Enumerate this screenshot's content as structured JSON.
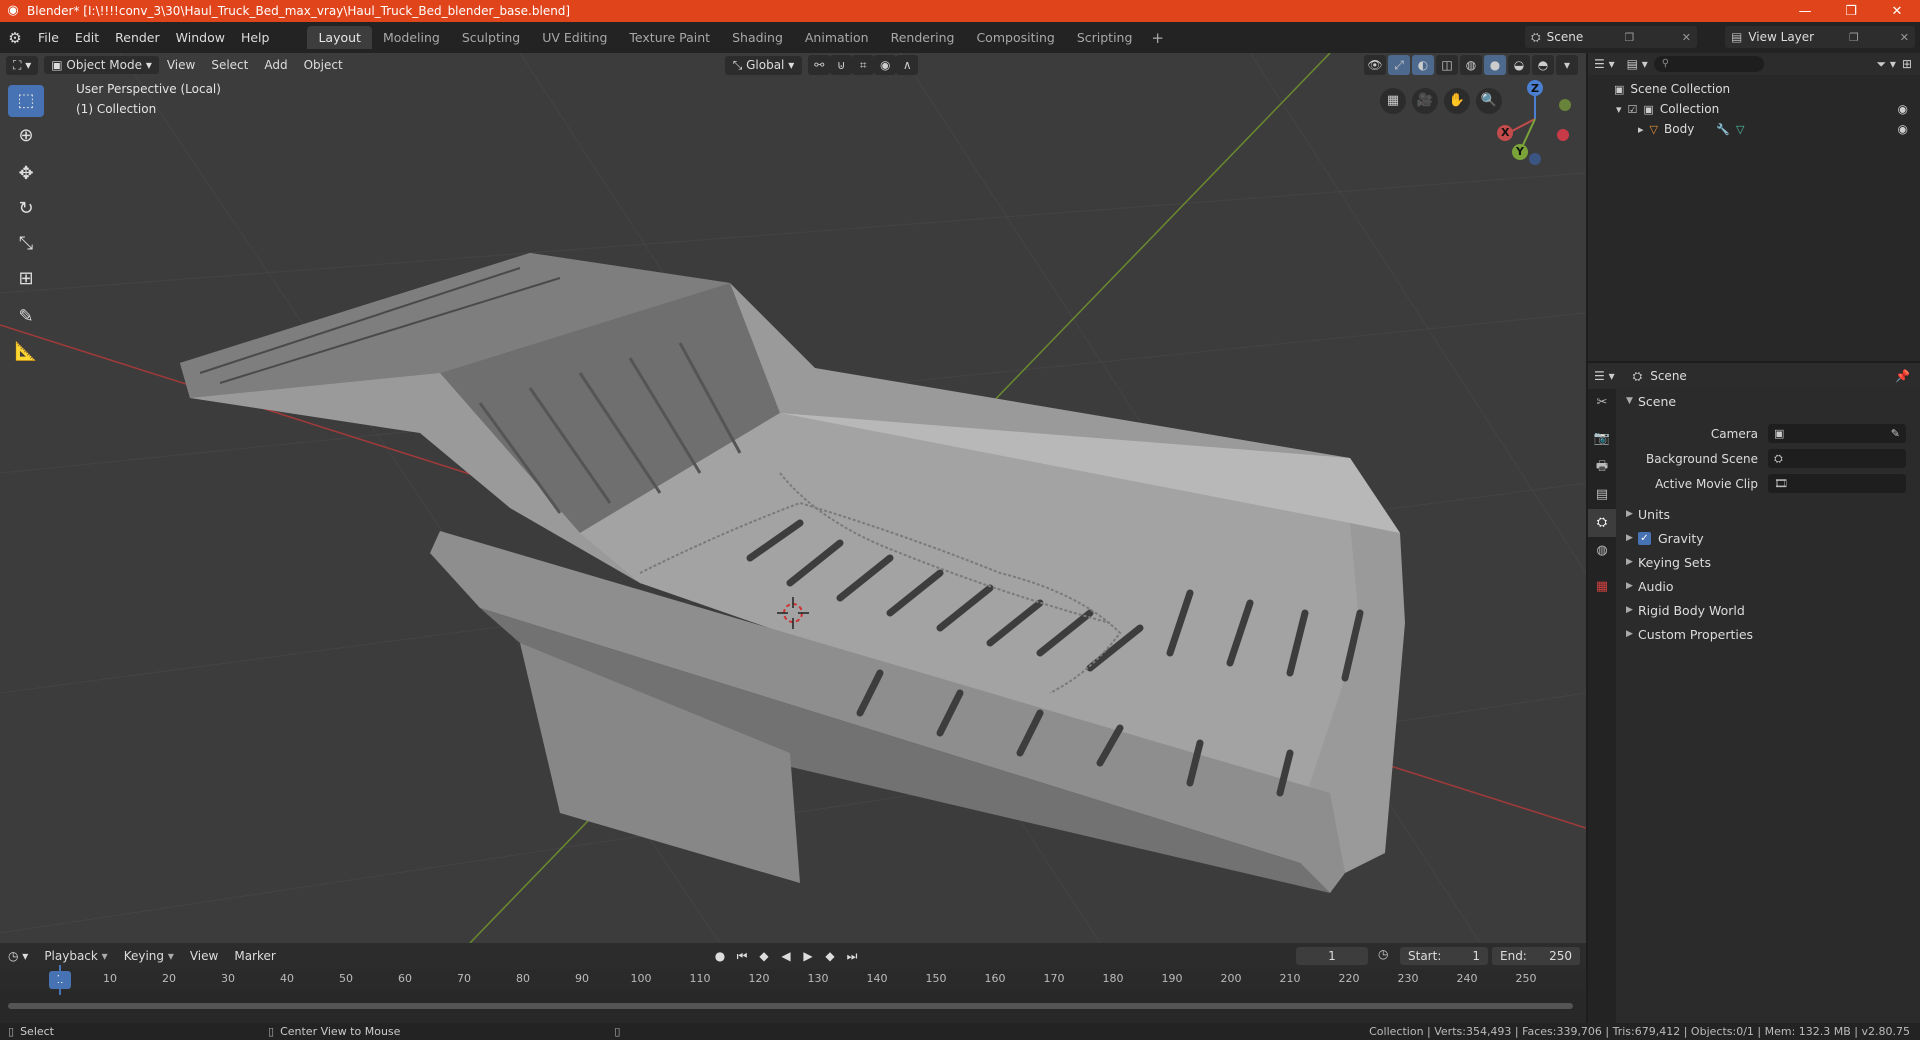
{
  "window": {
    "title": "Blender* [I:\\!!!!conv_3\\30\\Haul_Truck_Bed_max_vray\\Haul_Truck_Bed_blender_base.blend]",
    "min": "—",
    "max": "❐",
    "close": "✕"
  },
  "menu": [
    "File",
    "Edit",
    "Render",
    "Window",
    "Help"
  ],
  "workspaces": [
    "Layout",
    "Modeling",
    "Sculpting",
    "UV Editing",
    "Texture Paint",
    "Shading",
    "Animation",
    "Rendering",
    "Compositing",
    "Scripting"
  ],
  "workspace_add": "+",
  "scene_selector": "Scene",
  "view_layer_selector": "View Layer",
  "viewport": {
    "mode": "Object Mode",
    "menus": [
      "View",
      "Select",
      "Add",
      "Object"
    ],
    "transform_orientation": "Global",
    "info_line1": "User Perspective (Local)",
    "info_line2": "(1) Collection"
  },
  "gizmo": {
    "x": "X",
    "y": "Y",
    "z": "Z"
  },
  "outliner": {
    "root": "Scene Collection",
    "collection": "Collection",
    "object": "Body"
  },
  "properties": {
    "header": "Scene",
    "panel": "Scene",
    "camera_label": "Camera",
    "background_scene_label": "Background Scene",
    "active_movie_clip_label": "Active Movie Clip",
    "sections": [
      "Units",
      "Gravity",
      "Keying Sets",
      "Audio",
      "Rigid Body World",
      "Custom Properties"
    ],
    "gravity_checked": true
  },
  "timeline": {
    "menus": [
      "Playback",
      "Keying",
      "View",
      "Marker"
    ],
    "current_frame": "1",
    "start_label": "Start:",
    "start": "1",
    "end_label": "End:",
    "end": "250",
    "ticks": [
      "10",
      "20",
      "30",
      "40",
      "50",
      "60",
      "70",
      "80",
      "90",
      "100",
      "110",
      "120",
      "130",
      "140",
      "150",
      "160",
      "170",
      "180",
      "190",
      "200",
      "210",
      "220",
      "230",
      "240",
      "250"
    ]
  },
  "status": {
    "left": "Select",
    "middle": "Center View to Mouse",
    "stats": "Collection | Verts:354,493 | Faces:339,706 | Tris:679,412 | Objects:0/1 | Mem: 132.3 MB | v2.80.75"
  },
  "colors": {
    "accent": "#4772b3",
    "titlebar": "#e0441b",
    "axis_x": "#c34b4b",
    "axis_y": "#7aa339",
    "axis_z": "#4a7fd1"
  }
}
